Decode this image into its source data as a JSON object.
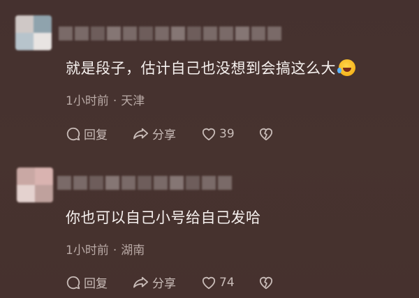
{
  "comments": [
    {
      "text": "就是段子，估计自己也没想到会搞这么大",
      "emoji": "rolling-on-floor-laughing-emoji",
      "time": "1小时前",
      "location": "天津",
      "reply_label": "回复",
      "share_label": "分享",
      "likes": "39"
    },
    {
      "text": "你也可以自己小号给自己发哈",
      "time": "1小时前",
      "location": "湖南",
      "reply_label": "回复",
      "share_label": "分享",
      "likes": "74"
    }
  ],
  "meta_separator": "·",
  "icons": {
    "reply": "comment-bubble-icon",
    "share": "share-arrow-icon",
    "like": "heart-icon",
    "dislike": "broken-heart-icon"
  },
  "colors": {
    "background": "#46312f",
    "text": "#f6f1ef",
    "meta": "#b9aaa6",
    "actions": "#c9bcb8"
  }
}
